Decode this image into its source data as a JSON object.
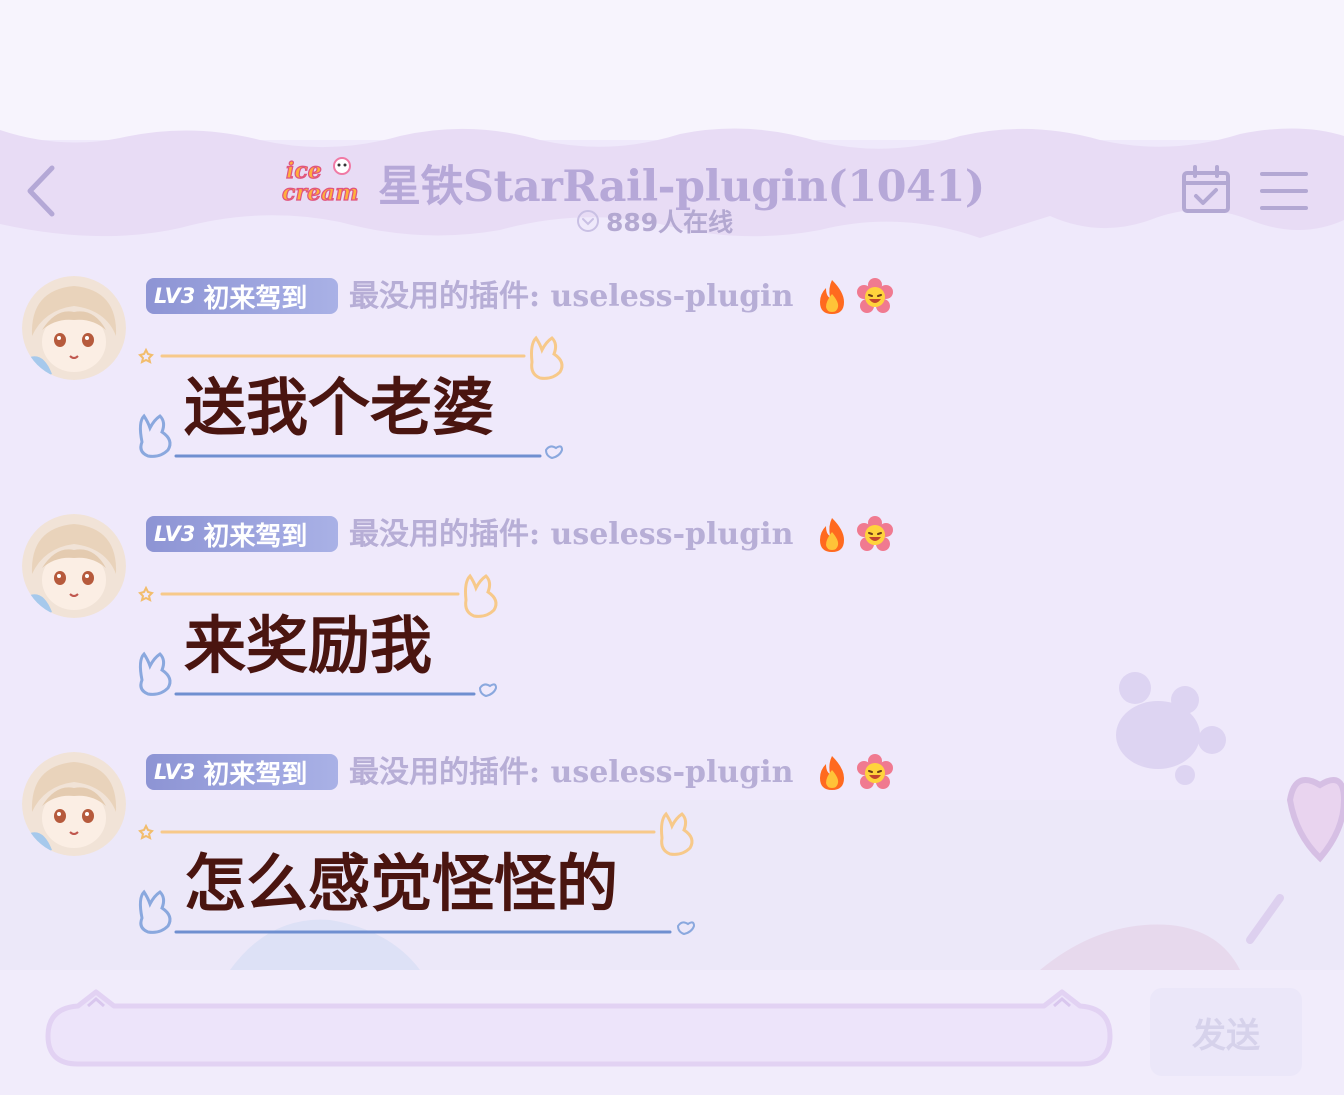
{
  "header": {
    "logo_text_line1": "ice",
    "logo_text_line2": "cream",
    "channel_title": "星铁StarRail-plugin(1041)",
    "online_count": "889人在线"
  },
  "messages": [
    {
      "level": "LV3",
      "level_title": "初来驾到",
      "sender": "最没用的插件: useless-plugin",
      "text": "送我个老婆"
    },
    {
      "level": "LV3",
      "level_title": "初来驾到",
      "sender": "最没用的插件: useless-plugin",
      "text": "来奖励我"
    },
    {
      "level": "LV3",
      "level_title": "初来驾到",
      "sender": "最没用的插件: useless-plugin",
      "text": "怎么感觉怪怪的"
    }
  ],
  "composer": {
    "input_value": "",
    "send_label": "发送"
  },
  "icons": [
    "back-arrow-icon",
    "calendar-check-icon",
    "hamburger-menu-icon",
    "flame-icon",
    "flower-smile-icon"
  ],
  "colors": {
    "background": "#efe9fb",
    "badge": "#8d94d4",
    "muted_text": "#b7aed6",
    "message_text": "#4a1510",
    "bubble_top_line": "#f7c98a",
    "bubble_bottom_line": "#6f8fd0"
  }
}
